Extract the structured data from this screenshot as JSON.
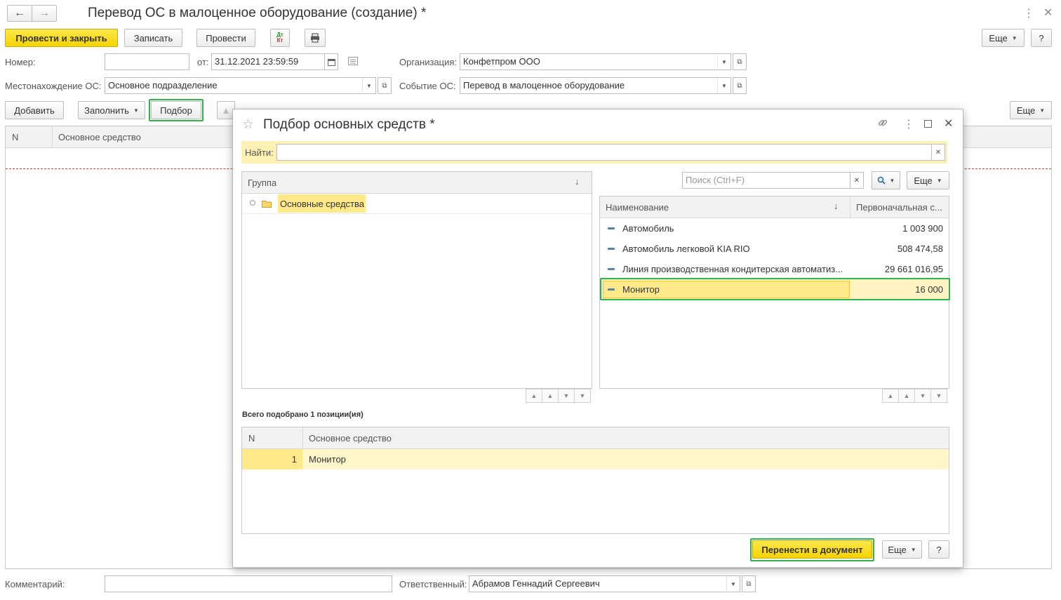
{
  "window": {
    "title": "Перевод ОС в малоценное оборудование (создание) *",
    "more_label": "Еще",
    "help_label": "?"
  },
  "toolbar": {
    "post_close_label": "Провести и закрыть",
    "save_label": "Записать",
    "post_label": "Провести",
    "dt_kt_line1": "Дт",
    "dt_kt_line2": "Кт"
  },
  "form": {
    "number_label": "Номер:",
    "number_value": "",
    "date_label": "от:",
    "date_value": "31.12.2021 23:59:59",
    "org_label": "Организация:",
    "org_value": "Конфетпром ООО",
    "location_label": "Местонахождение ОС:",
    "location_value": "Основное подразделение",
    "event_label": "Событие ОС:",
    "event_value": "Перевод в малоценное оборудование",
    "comment_label": "Комментарий:",
    "comment_value": "",
    "responsible_label": "Ответственный:",
    "responsible_value": "Абрамов Геннадий Сергеевич"
  },
  "table_toolbar": {
    "add_label": "Добавить",
    "fill_label": "Заполнить",
    "select_label": "Подбор",
    "more_label": "Еще"
  },
  "main_table": {
    "columns": [
      "N",
      "Основное средство"
    ]
  },
  "dialog": {
    "title": "Подбор основных средств *",
    "find_label": "Найти:",
    "find_value": "",
    "group_header": "Группа",
    "groups": [
      "Основные средства"
    ],
    "search_placeholder": "Поиск (Ctrl+F)",
    "more_label": "Еще",
    "columns": [
      "Наименование",
      "Первоначальная с..."
    ],
    "items": [
      {
        "name": "Автомобиль",
        "cost": "1 003 900"
      },
      {
        "name": "Автомобиль легковой KIA RIO",
        "cost": "508 474,58"
      },
      {
        "name": "Линия производственная кондитерская автоматиз...",
        "cost": "29 661 016,95"
      },
      {
        "name": "Монитор",
        "cost": "16 000"
      }
    ],
    "selected_summary": "Всего подобрано 1 позиции(ия)",
    "selected_columns": [
      "N",
      "Основное средство"
    ],
    "selected_rows": [
      {
        "n": "1",
        "asset": "Монитор"
      }
    ],
    "transfer_label": "Перенести в документ",
    "help_label": "?"
  },
  "colors": {
    "accent_yellow": "#f5d300",
    "highlight": "#ffe98a",
    "frame_green": "#2fb34a"
  }
}
